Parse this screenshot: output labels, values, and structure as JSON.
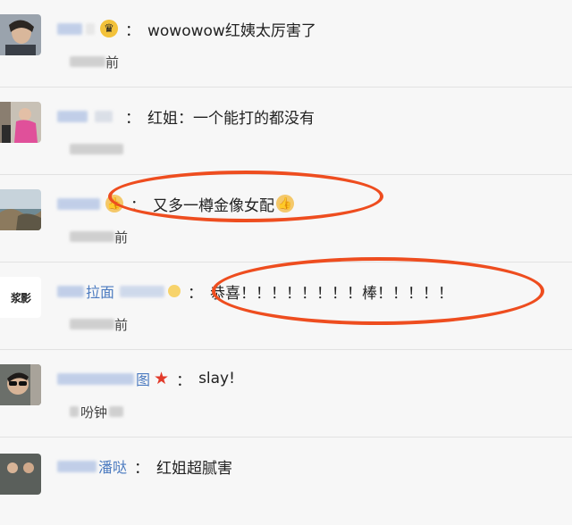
{
  "comments": [
    {
      "name_visible": "",
      "comment": "wowowow红姨太厉害了",
      "meta_visible": "前"
    },
    {
      "name_visible": "",
      "comment": "红姐：一个能打的都没有",
      "meta_visible": ""
    },
    {
      "name_visible": "",
      "comment": "又多一樽金像女配",
      "meta_visible": "前"
    },
    {
      "name_visible": "拉面",
      "comment": "恭喜！！！！！！！！棒！！！！！",
      "meta_visible": "前"
    },
    {
      "name_visible": "图",
      "comment": "slay!",
      "meta_visible": "吩钟"
    },
    {
      "name_visible": "潘哒",
      "comment": "红姐超腻害",
      "meta_visible": ""
    }
  ],
  "avatar_texts": {
    "row4": "浆影"
  },
  "colors": {
    "link_blue": "#4c7bc0",
    "highlight_red": "#ee4d1f",
    "background": "#f7f7f7"
  },
  "icons": [
    "crown-face-emoji-icon",
    "thumbs-up-emoji-icon",
    "red-star-icon"
  ]
}
